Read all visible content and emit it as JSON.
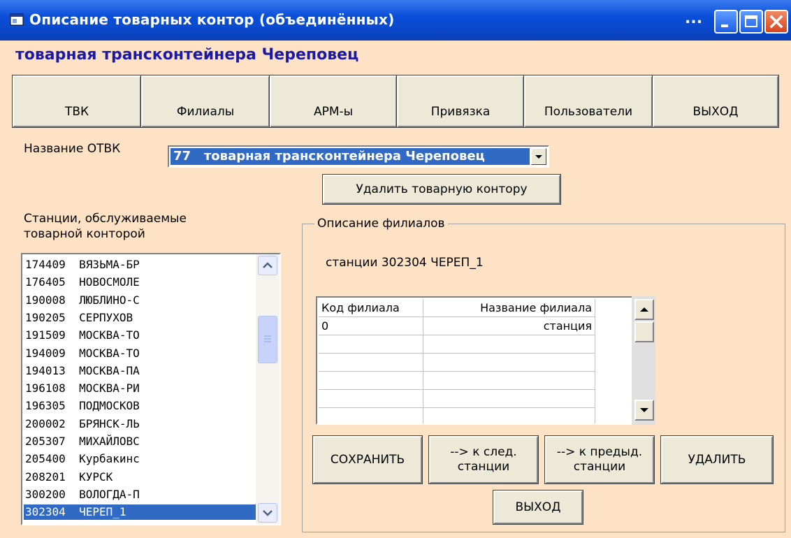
{
  "window": {
    "title": "Описание товарных контор (объединённых)",
    "title_dots": "...",
    "subtitle": "товарная трансконтейнера Череповец"
  },
  "toolbar": {
    "buttons": [
      "ТВК",
      "Филиалы",
      "АРМ-ы",
      "Привязка",
      "Пользователи",
      "ВЫХОД"
    ]
  },
  "otvk": {
    "label": "Название ОТВК",
    "selected_code": "77",
    "selected_name": "товарная трансконтейнера Череповец",
    "delete_label": "Удалить товарную контору"
  },
  "stations": {
    "label_line1": "Станции, обслуживаемые",
    "label_line2": "товарной конторой",
    "items": [
      {
        "code": "174409",
        "name": "ВЯЗЬМА-БР"
      },
      {
        "code": "176405",
        "name": "НОВОСМОЛЕ"
      },
      {
        "code": "190008",
        "name": "ЛЮБЛИНО-С"
      },
      {
        "code": "190205",
        "name": "СЕРПУХОВ"
      },
      {
        "code": "191509",
        "name": "МОСКВА-ТО"
      },
      {
        "code": "194009",
        "name": "МОСКВА-ТО"
      },
      {
        "code": "194013",
        "name": "МОСКВА-ПА"
      },
      {
        "code": "196108",
        "name": "МОСКВА-РИ"
      },
      {
        "code": "196305",
        "name": "ПОДМОСКОВ"
      },
      {
        "code": "200002",
        "name": "БРЯНСК-ЛЬ"
      },
      {
        "code": "205307",
        "name": "МИХАЙЛОВС"
      },
      {
        "code": "205400",
        "name": "Курбакинс"
      },
      {
        "code": "208201",
        "name": "КУРСК"
      },
      {
        "code": "300200",
        "name": "ВОЛОГДА-П"
      },
      {
        "code": "302304",
        "name": "ЧЕРЕП_1"
      }
    ],
    "selected_index": 14
  },
  "branches": {
    "group_title": "Описание филиалов",
    "station_caption": "станции 302304  ЧЕРЕП_1",
    "grid": {
      "headers": [
        "Код филиала",
        "Название филиала"
      ],
      "rows": [
        [
          "0",
          "станция"
        ]
      ]
    },
    "buttons": {
      "save": "СОХРАНИТЬ",
      "next_line1": "--> к след.",
      "next_line2": "станции",
      "prev_line1": "--> к предыд.",
      "prev_line2": "станции",
      "delete": "УДАЛИТЬ",
      "exit": "ВЫХОД"
    }
  },
  "colors": {
    "form_background": "#fde2c6",
    "titlebar": "#0a4fd8",
    "selection": "#316ac5",
    "subtitle": "#1a1aa6"
  }
}
